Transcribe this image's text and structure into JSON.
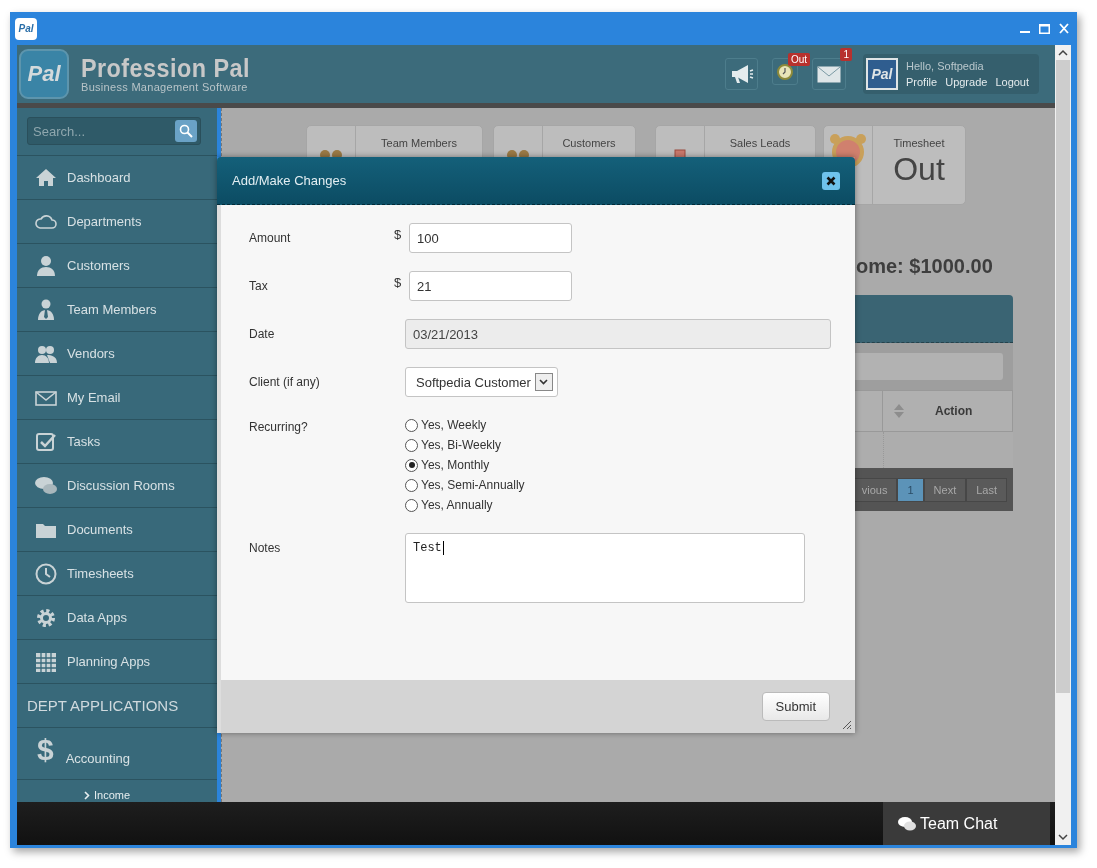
{
  "window": {
    "icon_text": "Pal"
  },
  "header": {
    "logo_mark": "Pal",
    "brand": "Profession Pal",
    "tagline": "Business Management Software",
    "notifications": [
      {
        "kind": "announce"
      },
      {
        "kind": "clock",
        "badge": "Out"
      },
      {
        "kind": "mail",
        "badge": "1"
      }
    ],
    "user": {
      "logo_mark": "Pal",
      "greeting": "Hello, Softpedia",
      "links": [
        "Profile",
        "Upgrade",
        "Logout"
      ]
    }
  },
  "sidebar": {
    "search": {
      "placeholder": "Search..."
    },
    "items": [
      {
        "kind": "link",
        "label": "Dashboard"
      },
      {
        "kind": "link",
        "label": "Departments"
      },
      {
        "kind": "link",
        "label": "Customers"
      },
      {
        "kind": "link",
        "label": "Team Members"
      },
      {
        "kind": "link",
        "label": "Vendors"
      },
      {
        "kind": "link",
        "label": "My Email"
      },
      {
        "kind": "link",
        "label": "Tasks"
      },
      {
        "kind": "link",
        "label": "Discussion Rooms"
      },
      {
        "kind": "link",
        "label": "Documents"
      },
      {
        "kind": "link",
        "label": "Timesheets"
      },
      {
        "kind": "link",
        "label": "Data Apps"
      },
      {
        "kind": "link",
        "label": "Planning Apps"
      },
      {
        "kind": "heading",
        "label": "DEPT APPLICATIONS"
      },
      {
        "kind": "app",
        "glyph": "$",
        "label": "Accounting"
      },
      {
        "kind": "subitem",
        "label": "Income"
      }
    ]
  },
  "cards": [
    {
      "label": "Team Members"
    },
    {
      "label": "Customers"
    },
    {
      "label": "Sales Leads"
    },
    {
      "label": "Timesheet",
      "value": "Out"
    }
  ],
  "income_heading": "ome: $1000.00",
  "table": {
    "columns": [
      {
        "label": "Action"
      }
    ],
    "pagination": [
      {
        "label": "vious",
        "selected": false
      },
      {
        "label": "1",
        "selected": true
      },
      {
        "label": "Next",
        "selected": false
      },
      {
        "label": "Last",
        "selected": false
      }
    ]
  },
  "dialog": {
    "title": "Add/Make Changes",
    "fields": [
      {
        "kind": "money",
        "label": "Amount",
        "prefix": "$",
        "value": "100"
      },
      {
        "kind": "money",
        "label": "Tax",
        "prefix": "$",
        "value": "21"
      },
      {
        "kind": "text",
        "label": "Date",
        "value": "03/21/2013",
        "disabled": true
      },
      {
        "kind": "select",
        "label": "Client (if any)",
        "value": "Softpedia Customer"
      },
      {
        "kind": "radio",
        "label": "Recurring?",
        "options": [
          {
            "label": "Yes, Weekly",
            "selected": false
          },
          {
            "label": "Yes, Bi-Weekly",
            "selected": false
          },
          {
            "label": "Yes, Monthly",
            "selected": true
          },
          {
            "label": "Yes, Semi-Annually",
            "selected": false
          },
          {
            "label": "Yes, Annually",
            "selected": false
          }
        ]
      },
      {
        "kind": "textarea",
        "label": "Notes",
        "value": "Test"
      }
    ],
    "submit": "Submit"
  },
  "chat": {
    "label": "Team Chat"
  }
}
